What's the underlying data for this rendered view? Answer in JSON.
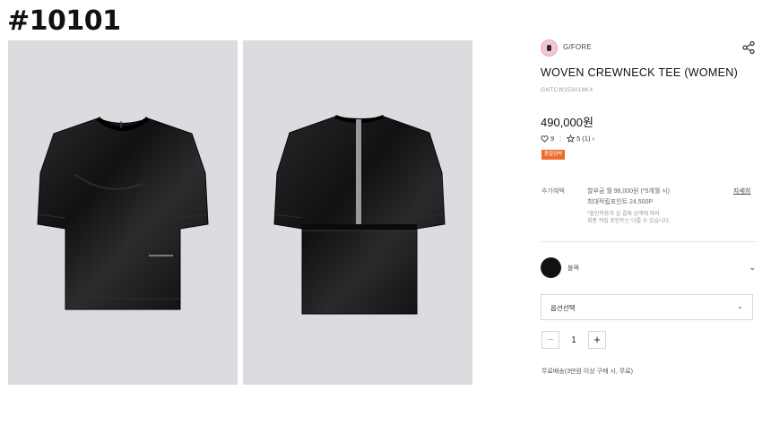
{
  "page_id": "#10101",
  "gallery": {
    "images": [
      {
        "name": "front-view",
        "color": "#dcdce0"
      },
      {
        "name": "back-view",
        "color": "#dcdce0"
      }
    ]
  },
  "brand": {
    "name": "G/FORE",
    "logo_color": "#f3c6d2"
  },
  "product": {
    "title": "WOVEN CREWNECK TEE (WOMEN)",
    "code": "GNTCW253018KX",
    "price": "490,000원"
  },
  "meta": {
    "likes_icon": "heart-icon",
    "likes": "9",
    "rating_icon": "star-icon",
    "rating": "5",
    "review_count": "(1)",
    "review_chevron": "›"
  },
  "badge": {
    "label": "품절임박",
    "color": "#ee6b2d"
  },
  "benefits": {
    "label": "추가혜택",
    "line1": "할부금 월 98,000원 (*5개월 시)",
    "line2": "최대적립포인트 24,500P",
    "note1": "*할인적용과 실 결제 금액에 따라",
    "note2": "최종 적립 포인트는 다를 수 있습니다.",
    "detail_link": "자세히"
  },
  "color_option": {
    "name": "블랙",
    "swatch": "#111111",
    "chevron": "⌄"
  },
  "option_select": {
    "label": "옵션선택",
    "chevron": "⌄"
  },
  "quantity": {
    "minus": "−",
    "value": "1",
    "plus": "+"
  },
  "shipping": {
    "text": "무료배송(3만원 이상 구매 시, 무료)"
  }
}
